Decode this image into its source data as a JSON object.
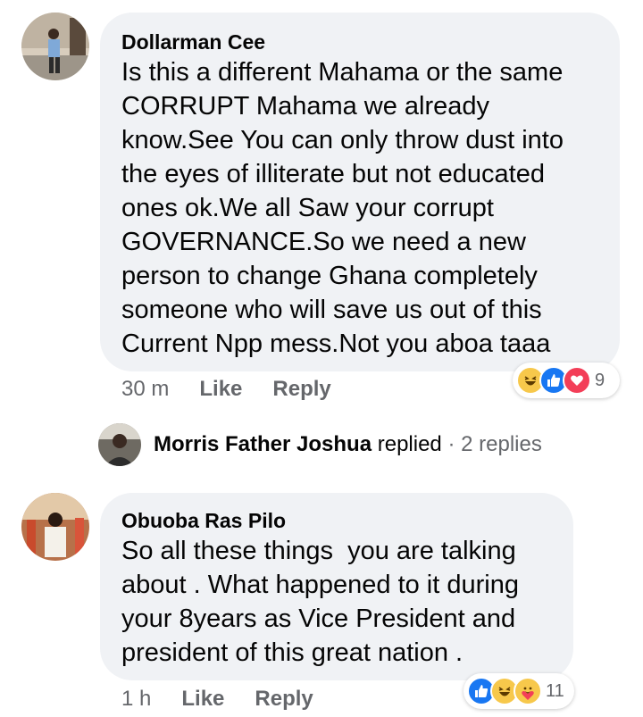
{
  "comments": [
    {
      "author": "Dollarman Cee",
      "text": "Is this a different Mahama or the same\nCORRUPT Mahama we already\nknow.See You can only throw dust into\nthe eyes of illiterate but not educated\nones ok.We all Saw your corrupt\nGOVERNANCE.So we need a new\nperson to change Ghana completely\nsomeone who will save us out of this\nCurrent Npp mess.Not you aboa taaa",
      "time": "30 m",
      "like_label": "Like",
      "reply_label": "Reply",
      "reactions": [
        "haha",
        "like",
        "love"
      ],
      "reaction_count": "9"
    },
    {
      "author": "Obuoba Ras Pilo",
      "text": "So all these things  you are talking\nabout . What happened to it during\nyour 8years as Vice President and\npresident of this great nation .",
      "time": "1 h",
      "like_label": "Like",
      "reply_label": "Reply",
      "reactions": [
        "like",
        "haha",
        "care"
      ],
      "reaction_count": "11"
    }
  ],
  "reply_summary": {
    "name": "Morris Father Joshua",
    "action": "replied",
    "separator": "·",
    "count": "2 replies"
  },
  "colors": {
    "bubble": "#f0f2f5",
    "muted": "#65676b",
    "like_blue": "#1877f2",
    "love_red": "#f33e58",
    "haha_yellow": "#f7c84b"
  }
}
